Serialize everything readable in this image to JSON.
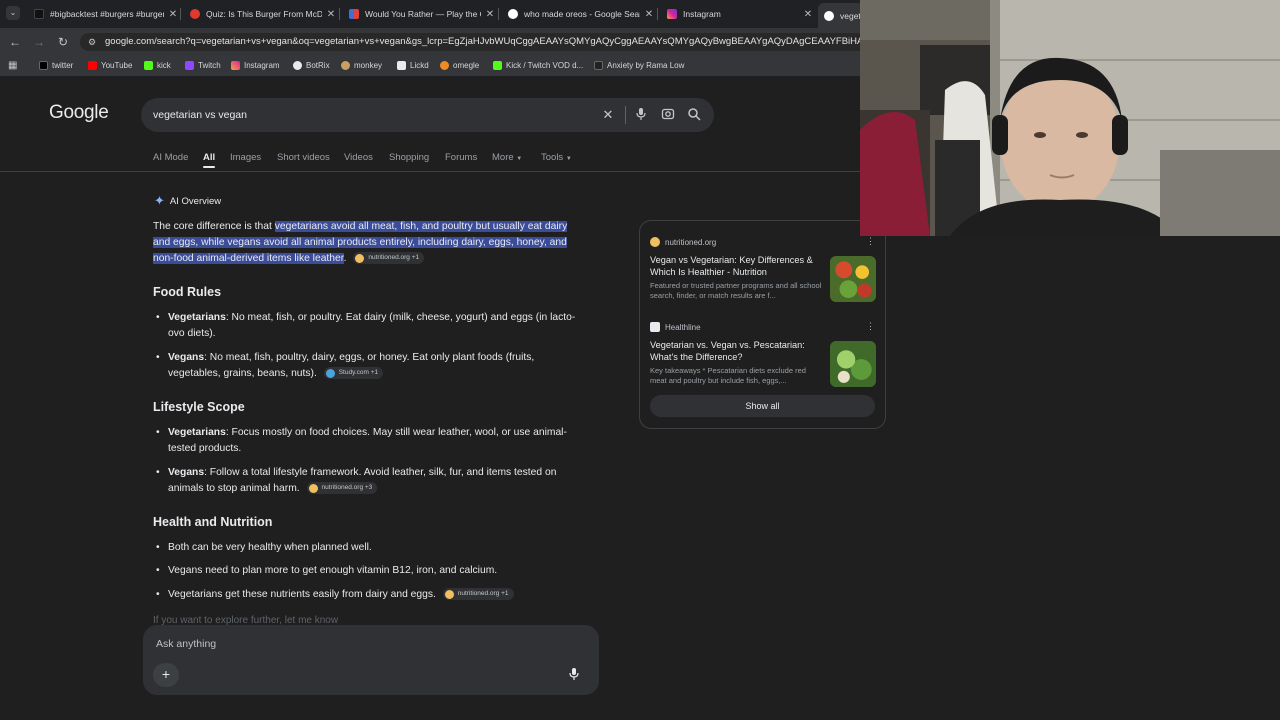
{
  "browser": {
    "tabs": [
      {
        "title": "#bigbacktest #burgers #burger",
        "color": "#111111"
      },
      {
        "title": "Quiz: Is This Burger From McDo",
        "color": "#e03a2f"
      },
      {
        "title": "Would You Rather — Play the Q",
        "color": "#3b6fd9"
      },
      {
        "title": "who made oreos - Google Searc",
        "color": "#4285f4"
      },
      {
        "title": "Instagram",
        "color": "#d6249f"
      },
      {
        "title": "veget",
        "color": "#4285f4"
      }
    ],
    "url": "google.com/search?q=vegetarian+vs+vegan&oq=vegetarian+vs+vegan&gs_lcrp=EgZjaHJvbWUqCggAEAAYsQMYgAQyCggAEAAYsQMYgAQyBwgBEAAYgAQyDAgCEAAYFBiHAhiABDIH",
    "bookmarks": [
      {
        "label": "twitter",
        "color": "#000000"
      },
      {
        "label": "YouTube",
        "color": "#ff0000"
      },
      {
        "label": "kick",
        "color": "#53fc18"
      },
      {
        "label": "Twitch",
        "color": "#9146ff"
      },
      {
        "label": "Instagram",
        "color": "#d6249f"
      },
      {
        "label": "BotRix",
        "color": "#e8eaed"
      },
      {
        "label": "monkey",
        "color": "#c8a060"
      },
      {
        "label": "Lickd",
        "color": "#e8eaed"
      },
      {
        "label": "omegle",
        "color": "#f08a24"
      },
      {
        "label": "Kick / Twitch VOD d...",
        "color": "#53fc18"
      },
      {
        "label": "Anxiety by Rama Low",
        "color": "#222222"
      }
    ]
  },
  "google": {
    "logo": "Google",
    "query": "vegetarian vs vegan",
    "nav_tabs": [
      "AI Mode",
      "All",
      "Images",
      "Short videos",
      "Videos",
      "Shopping",
      "Forums",
      "More",
      "Tools"
    ]
  },
  "ai_overview": {
    "header": "AI Overview",
    "intro_plain": "The core difference is that ",
    "intro_hl_1": "vegetarians avoid all meat, fish, and poultry but usually eat dairy",
    "intro_hl_2": "and eggs, while vegans avoid all animal products entirely, including dairy, eggs, honey, and",
    "intro_hl_3": "non-food animal-derived items like leather",
    "intro_end": ".",
    "sections": [
      {
        "heading": "Food Rules",
        "bullets": [
          {
            "term": "Vegetarians",
            "line1": ": No meat, fish, or poultry. Eat dairy (milk, cheese, yogurt) and eggs (in lacto-",
            "line2": "ovo diets)."
          },
          {
            "term": "Vegans",
            "line1": ": No meat, fish, poultry, dairy, eggs, or honey. Eat only plant foods (fruits,",
            "line2": "vegetables, grains, beans, nuts)."
          }
        ]
      },
      {
        "heading": "Lifestyle Scope",
        "bullets": [
          {
            "term": "Vegetarians",
            "line1": ": Focus mostly on food choices. May still wear leather, wool, or use animal-",
            "line2": "tested products."
          },
          {
            "term": "Vegans",
            "line1": ": Follow a total lifestyle framework. Avoid leather, silk, fur, and items tested on",
            "line2": "animals to stop animal harm."
          }
        ]
      },
      {
        "heading": "Health and Nutrition",
        "bullets": [
          {
            "text": "Both can be very healthy when planned well."
          },
          {
            "text": "Vegans need to plan more to get enough vitamin B12, iron, and calcium."
          },
          {
            "text": "Vegetarians get these nutrients easily from dairy and eggs."
          }
        ]
      }
    ],
    "citations": {
      "intro": "nutritioned.org +1",
      "food_vegans": "Study.com +1",
      "lifestyle_vegans": "nutritioned.org +3",
      "health_last": "nutritioned.org +1"
    },
    "fade_text": "If you want to explore further, let me know"
  },
  "ask": {
    "placeholder": "Ask anything"
  },
  "sources_card": {
    "items": [
      {
        "source": "nutritioned.org",
        "title": "Vegan vs Vegetarian: Key Differences & Which Is Healthier - Nutrition",
        "snippet": "Featured or trusted partner programs and all school search, finder, or match results are f..."
      },
      {
        "source": "Healthline",
        "title": "Vegetarian vs. Vegan vs. Pescatarian: What's the Difference?",
        "snippet": "Key takeaways * Pescatarian diets exclude red meat and poultry but include fish, eggs,..."
      }
    ],
    "show_all": "Show all"
  },
  "colors": {
    "accent": "#8ab4f8",
    "highlight": "#3b4c9a",
    "background": "#1f1f1f"
  }
}
